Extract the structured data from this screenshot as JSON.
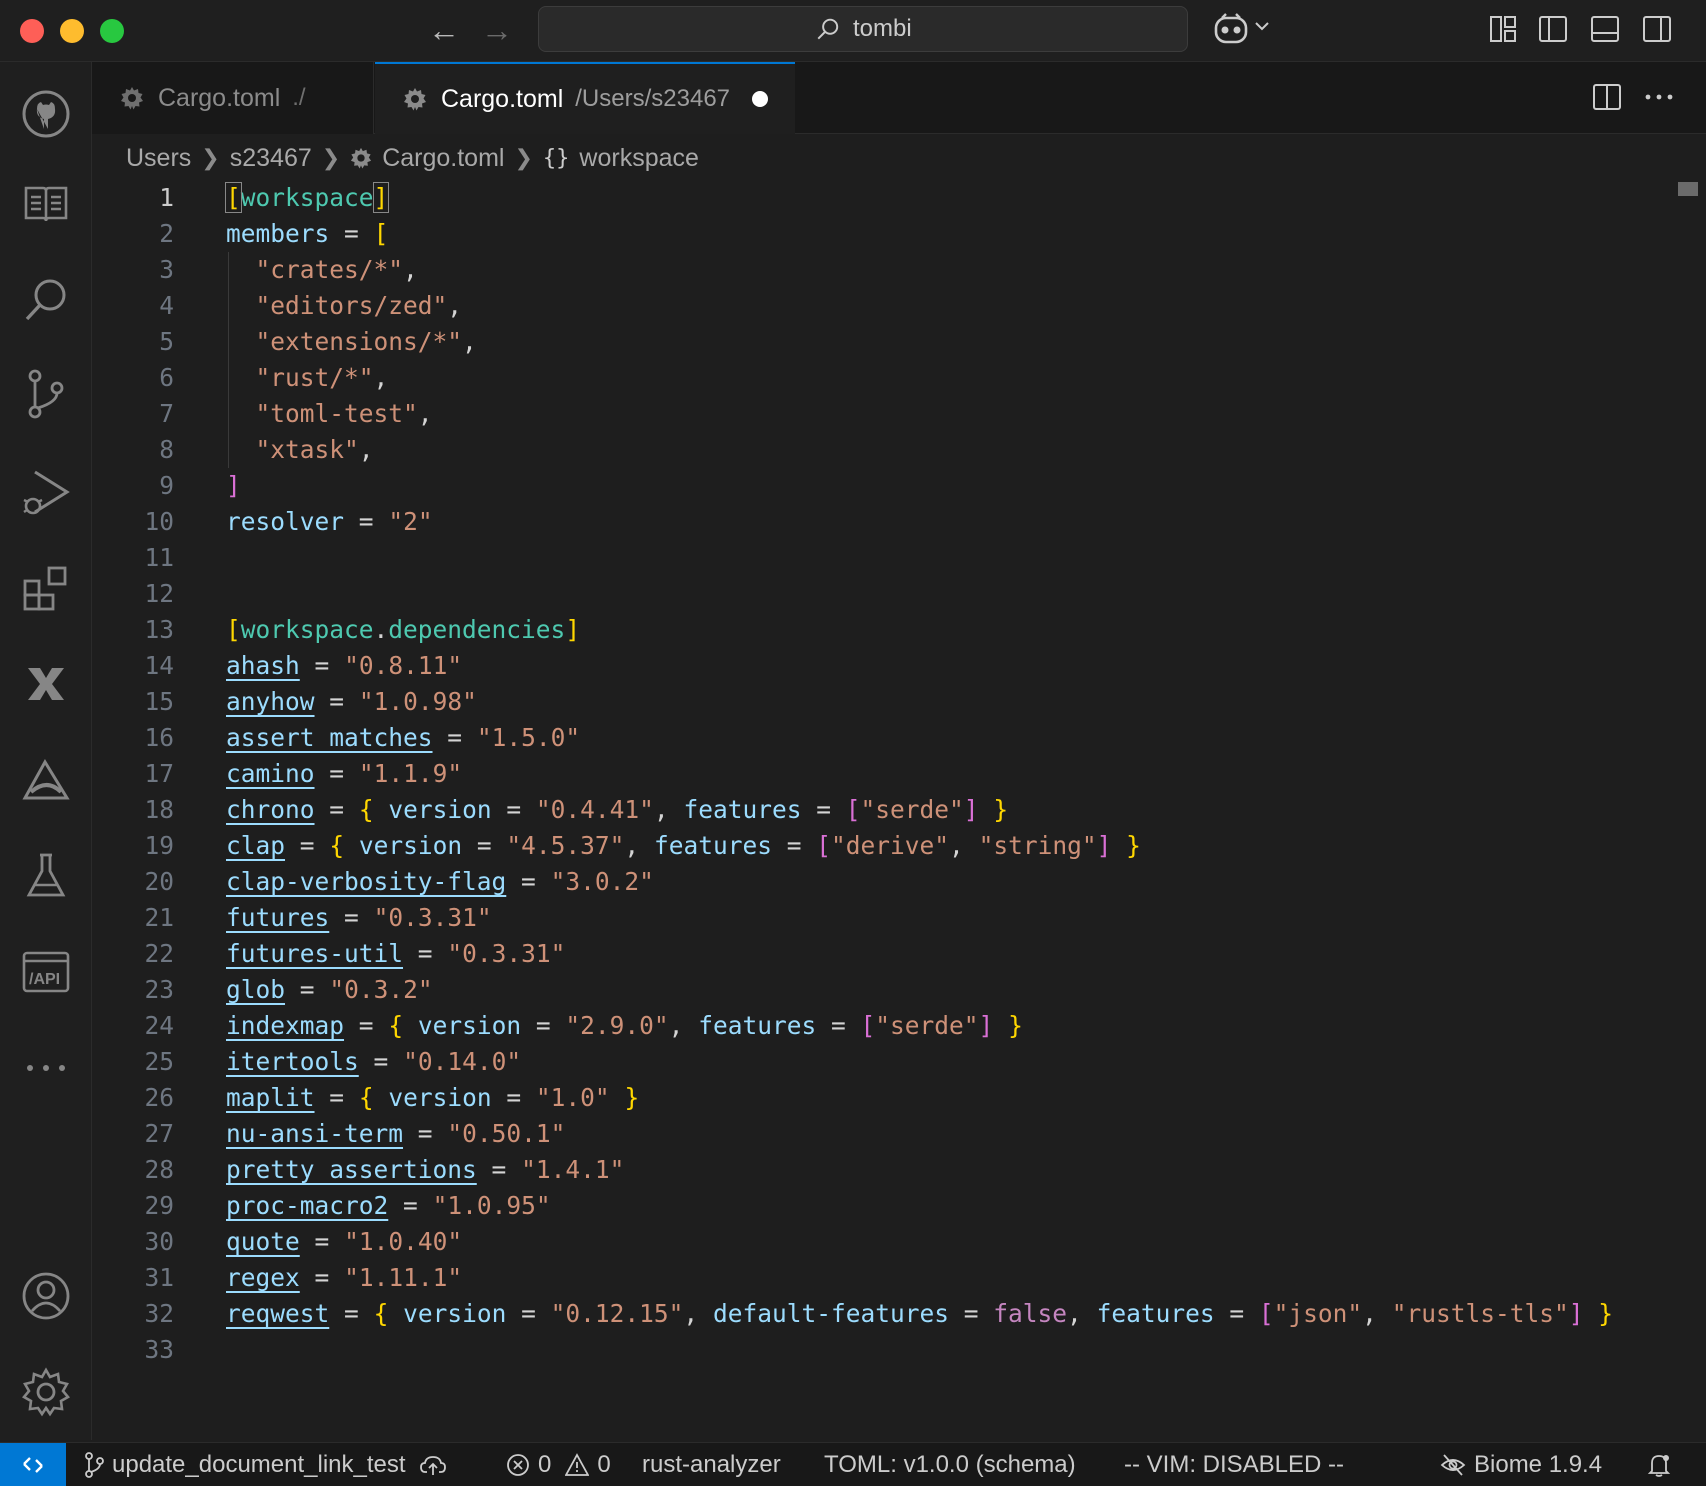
{
  "titlebar": {
    "search_text": "tombi"
  },
  "tabs": [
    {
      "label": "Cargo.toml",
      "description": "./",
      "active": false
    },
    {
      "label": "Cargo.toml",
      "description": "/Users/s23467",
      "active": true,
      "dirty": true
    }
  ],
  "breadcrumb": [
    "Users",
    "s23467",
    "Cargo.toml",
    "workspace"
  ],
  "breadcrumb_braces": "{}",
  "editor": {
    "active_line": 1,
    "lines": [
      "[workspace]",
      "members = [",
      "  \"crates/*\",",
      "  \"editors/zed\",",
      "  \"extensions/*\",",
      "  \"rust/*\",",
      "  \"toml-test\",",
      "  \"xtask\",",
      "]",
      "resolver = \"2\"",
      "",
      "",
      "[workspace.dependencies]",
      "ahash = \"0.8.11\"",
      "anyhow = \"1.0.98\"",
      "assert_matches = \"1.5.0\"",
      "camino = \"1.1.9\"",
      "chrono = { version = \"0.4.41\", features = [\"serde\"] }",
      "clap = { version = \"4.5.37\", features = [\"derive\", \"string\"] }",
      "clap-verbosity-flag = \"3.0.2\"",
      "futures = \"0.3.31\"",
      "futures-util = \"0.3.31\"",
      "glob = \"0.3.2\"",
      "indexmap = { version = \"2.9.0\", features = [\"serde\"] }",
      "itertools = \"0.14.0\"",
      "maplit = { version = \"1.0\" }",
      "nu-ansi-term = \"0.50.1\"",
      "pretty_assertions = \"1.4.1\"",
      "proc-macro2 = \"1.0.95\"",
      "quote = \"1.0.40\"",
      "regex = \"1.11.1\"",
      "reqwest = { version = \"0.12.15\", default-features = false, features = [\"json\", \"rustls-tls\"] }",
      ""
    ]
  },
  "statusbar": {
    "branch": "update_document_link_test",
    "errors": "0",
    "warnings": "0",
    "language_server": "rust-analyzer",
    "toml_schema": "TOML: v1.0.0 (schema)",
    "vim": "-- VIM: DISABLED --",
    "biome": "Biome 1.9.4"
  },
  "colors": {
    "accent": "#0078d4",
    "key": "#9cdcfe",
    "string": "#ce9178",
    "table": "#4ec9b0",
    "bracket_gold": "#ffd700",
    "bracket_purple": "#da70d6",
    "keyword": "#c586c0"
  },
  "icons": {
    "activity": [
      "github-icon",
      "docs-icon",
      "search-icon",
      "source-control-icon",
      "run-debug-icon",
      "extensions-icon",
      "remote-x-icon",
      "deploy-icon",
      "testing-flask-icon",
      "api-icon",
      "more-icon",
      "account-icon",
      "settings-gear-icon"
    ]
  }
}
